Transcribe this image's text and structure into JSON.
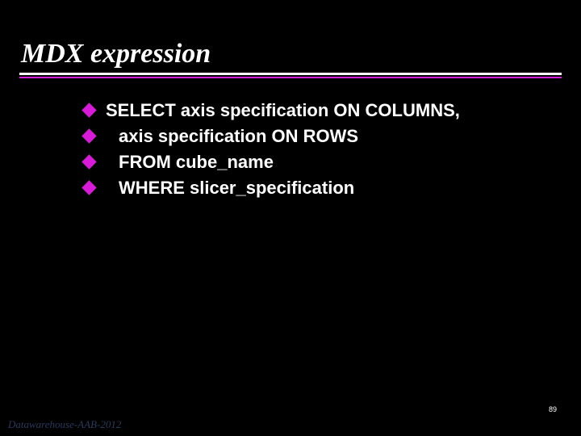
{
  "title": "MDX expression",
  "bullets": [
    {
      "text": "SELECT axis specification ON COLUMNS,",
      "indent": false
    },
    {
      "text": "axis specification ON ROWS",
      "indent": true
    },
    {
      "text": "FROM cube_name",
      "indent": true
    },
    {
      "text": "WHERE slicer_specification",
      "indent": true
    }
  ],
  "page_number": "89",
  "footer": "Datawarehouse-AAB-2012"
}
